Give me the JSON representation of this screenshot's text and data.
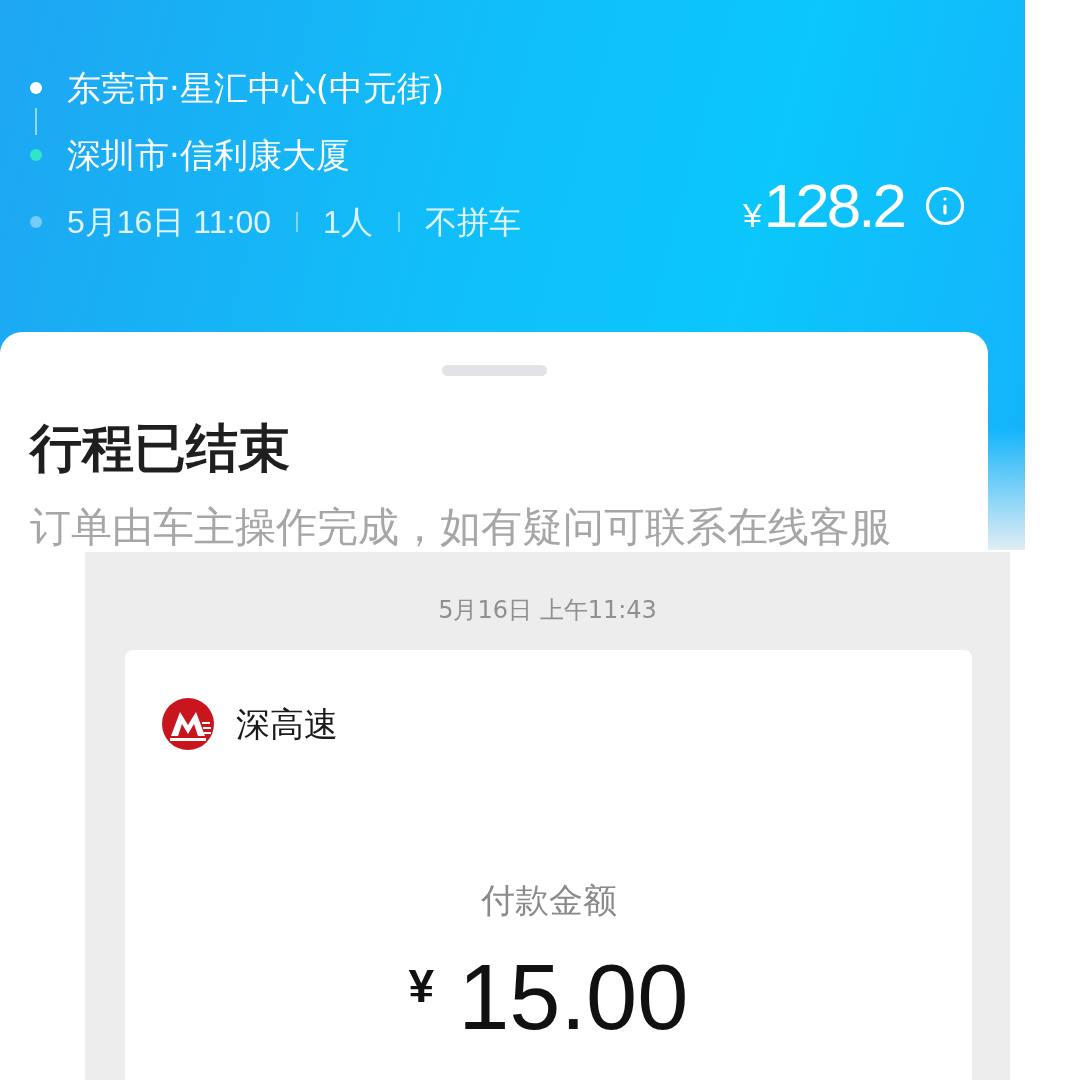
{
  "trip_header": {
    "route": [
      {
        "kind": "origin",
        "name": "东莞市·星汇中心(中元街)"
      },
      {
        "kind": "destination",
        "name": "深圳市·信利康大厦"
      }
    ],
    "details": [
      "5月16日 11:00",
      "1人",
      "不拼车"
    ],
    "price": {
      "currency": "¥",
      "amount": "128.2"
    }
  },
  "status_card": {
    "title": "行程已结束",
    "message": "订单由车主操作完成，如有疑问可联系在线客服"
  },
  "payment_message": {
    "timestamp": "5月16日 上午11:43",
    "sender": "深高速",
    "amount_label": "付款金额",
    "amount": {
      "currency": "¥",
      "value": "15.00"
    }
  }
}
